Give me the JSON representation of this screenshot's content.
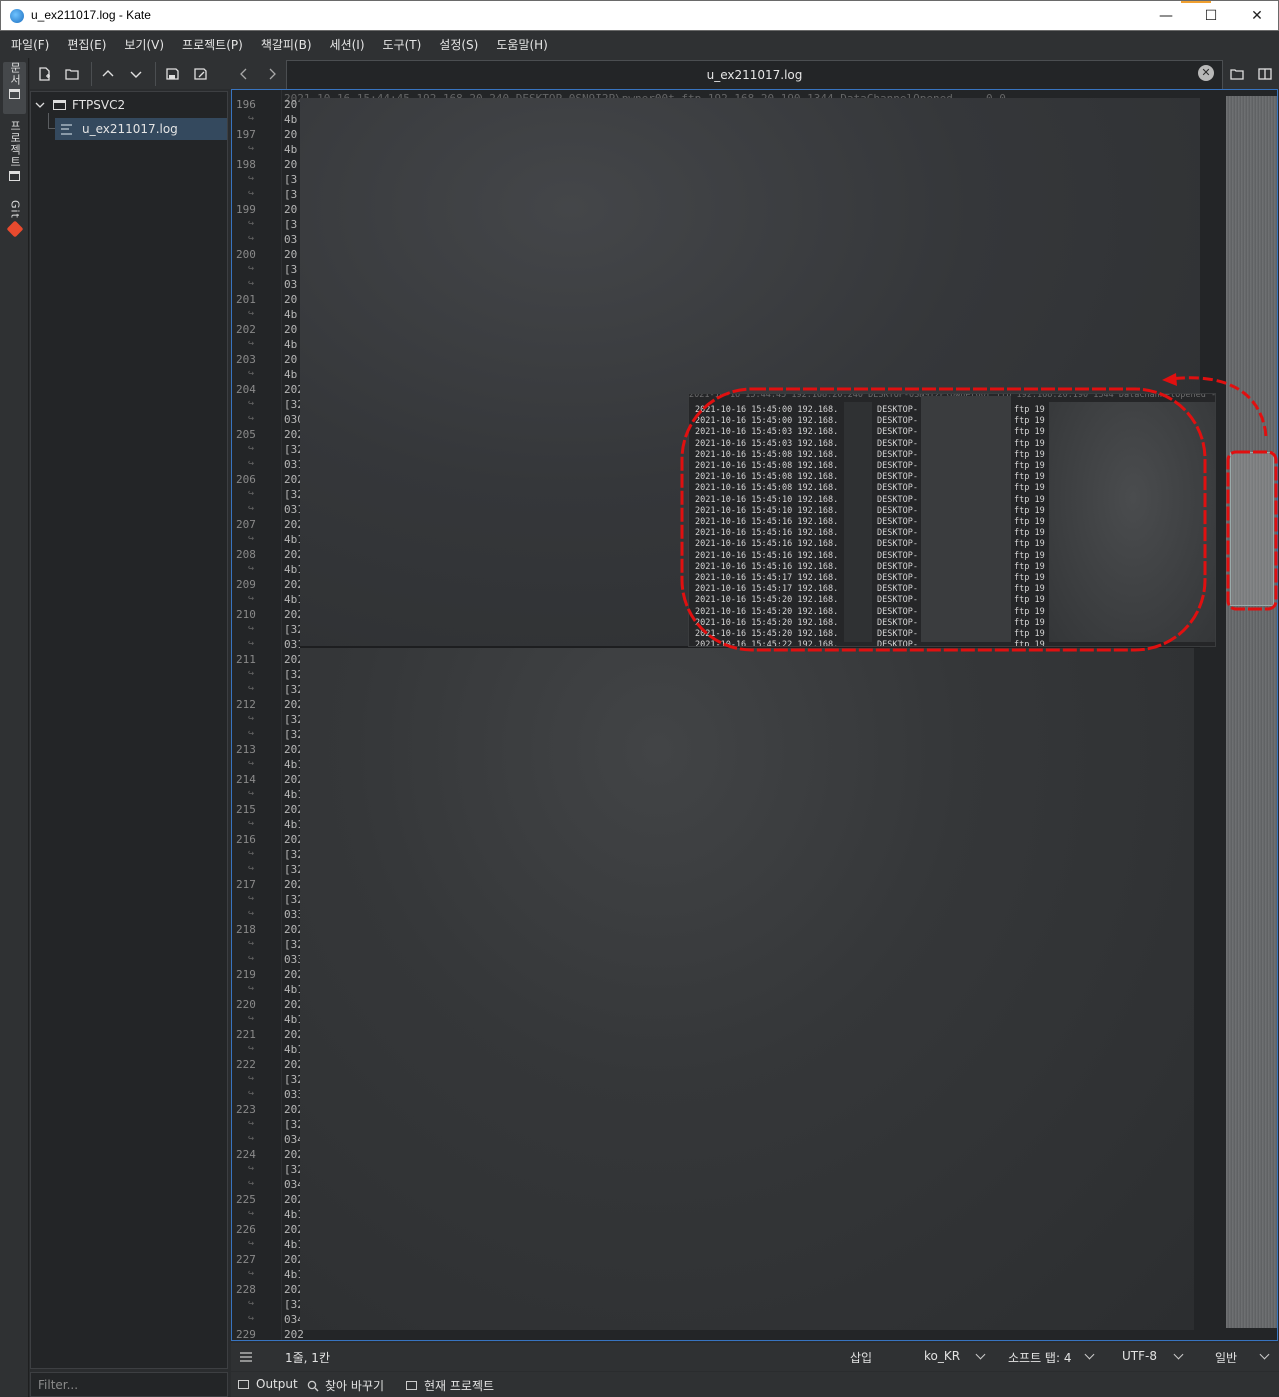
{
  "window": {
    "title": "u_ex211017.log  - Kate",
    "minimize": "—",
    "maximize": "☐",
    "close": "✕"
  },
  "menu": [
    "파일(F)",
    "편집(E)",
    "보기(V)",
    "프로젝트(P)",
    "책갈피(B)",
    "세션(I)",
    "도구(T)",
    "설정(S)",
    "도움말(H)"
  ],
  "sidebar": {
    "tabs": [
      {
        "label": "문서",
        "icon": "document-icon"
      },
      {
        "label": "프로젝트",
        "icon": "project-icon"
      },
      {
        "label": "Git",
        "icon": "git-icon"
      }
    ]
  },
  "tree": {
    "folder": "FTPSVC2",
    "file": "u_ex211017.log"
  },
  "filter": {
    "placeholder": "Filter..."
  },
  "tab": {
    "label": "u_ex211017.log",
    "close": "✕"
  },
  "editor": {
    "line_numbers": [
      "196",
      "197",
      "198",
      "199",
      "200",
      "201",
      "202",
      "203",
      "204",
      "205",
      "206",
      "207",
      "208",
      "209",
      "210",
      "211",
      "212",
      "213",
      "214",
      "215",
      "216",
      "217",
      "218",
      "219",
      "220",
      "221",
      "222",
      "223",
      "224",
      "225",
      "226",
      "227",
      "228",
      "229"
    ],
    "top_line": "2021-10-16 15:44:45 192.168.20.240 DESKTOP-0SN9I2P\\pwner00t ftp 192.168.20.190 1344 DataChannelOpened - - 0 0",
    "preview_rows": [
      {
        "time": "2021-10-16 15:45:00 192.168.",
        "host": "DESKTOP-",
        "ftp": "ftp 19"
      },
      {
        "time": "2021-10-16 15:45:00 192.168.",
        "host": "DESKTOP-",
        "ftp": "ftp 19"
      },
      {
        "time": "2021-10-16 15:45:03 192.168.",
        "host": "DESKTOP-",
        "ftp": "ftp 19"
      },
      {
        "time": "2021-10-16 15:45:03 192.168.",
        "host": "DESKTOP-",
        "ftp": "ftp 19"
      },
      {
        "time": "2021-10-16 15:45:08 192.168.",
        "host": "DESKTOP-",
        "ftp": "ftp 19"
      },
      {
        "time": "2021-10-16 15:45:08 192.168.",
        "host": "DESKTOP-",
        "ftp": "ftp 19"
      },
      {
        "time": "2021-10-16 15:45:08 192.168.",
        "host": "DESKTOP-",
        "ftp": "ftp 19"
      },
      {
        "time": "2021-10-16 15:45:08 192.168.",
        "host": "DESKTOP-",
        "ftp": "ftp 19"
      },
      {
        "time": "2021-10-16 15:45:10 192.168.",
        "host": "DESKTOP-",
        "ftp": "ftp 19"
      },
      {
        "time": "2021-10-16 15:45:10 192.168.",
        "host": "DESKTOP-",
        "ftp": "ftp 19"
      },
      {
        "time": "2021-10-16 15:45:16 192.168.",
        "host": "DESKTOP-",
        "ftp": "ftp 19"
      },
      {
        "time": "2021-10-16 15:45:16 192.168.",
        "host": "DESKTOP-",
        "ftp": "ftp 19"
      },
      {
        "time": "2021-10-16 15:45:16 192.168.",
        "host": "DESKTOP-",
        "ftp": "ftp 19"
      },
      {
        "time": "2021-10-16 15:45:16 192.168.",
        "host": "DESKTOP-",
        "ftp": "ftp 19"
      },
      {
        "time": "2021-10-16 15:45:16 192.168.",
        "host": "DESKTOP-",
        "ftp": "ftp 19"
      },
      {
        "time": "2021-10-16 15:45:17 192.168.",
        "host": "DESKTOP-",
        "ftp": "ftp 19"
      },
      {
        "time": "2021-10-16 15:45:17 192.168.",
        "host": "DESKTOP-",
        "ftp": "ftp 19"
      },
      {
        "time": "2021-10-16 15:45:20 192.168.",
        "host": "DESKTOP-",
        "ftp": "ftp 19"
      },
      {
        "time": "2021-10-16 15:45:20 192.168.",
        "host": "DESKTOP-",
        "ftp": "ftp 19"
      },
      {
        "time": "2021-10-16 15:45:20 192.168.",
        "host": "DESKTOP-",
        "ftp": "ftp 19"
      },
      {
        "time": "2021-10-16 15:45:20 192.168.",
        "host": "DESKTOP-",
        "ftp": "ftp 19"
      },
      {
        "time": "2021-10-16 15:45:22 192.168.",
        "host": "DESKTOP-",
        "ftp": "ftp 19"
      }
    ],
    "prefixes": [
      "20",
      "4b",
      "20",
      "4b",
      "20",
      "[3",
      "[3",
      "20",
      "[3",
      "03",
      "20",
      "[3",
      "03",
      "20",
      "4b",
      "20",
      "4b",
      "20",
      "4b",
      "202",
      "[32",
      "030",
      "202",
      "[32",
      "031",
      "202",
      "[32",
      "031",
      "202",
      "4b1",
      "202",
      "4b1",
      "202",
      "4b1",
      "202",
      "[32",
      "031",
      "202",
      "[32",
      "[32",
      "202",
      "[32",
      "[32",
      "202",
      "4b1",
      "202",
      "4b1",
      "202",
      "4b1",
      "202",
      "[32",
      "[32",
      "202",
      "[32",
      "033",
      "202",
      "[32",
      "033",
      "202",
      "4b1",
      "202",
      "4b1",
      "202",
      "4b1",
      "202",
      "[32",
      "033",
      "202",
      "[32",
      "034",
      "202",
      "[32",
      "034",
      "202",
      "4b1",
      "202",
      "4b1",
      "202",
      "4b1",
      "202",
      "[32",
      "034",
      "202"
    ]
  },
  "status": {
    "position": "1줄, 1칸",
    "mode": "삽입",
    "dictionary": "ko_KR",
    "indent": "소프트 탭: 4",
    "encoding": "UTF-8",
    "filetype": "일반"
  },
  "bottom": {
    "output": "Output",
    "search": "찾아 바꾸기",
    "project": "현재 프로젝트"
  },
  "colors": {
    "accent": "#3874c0",
    "annotation": "#e01010"
  }
}
